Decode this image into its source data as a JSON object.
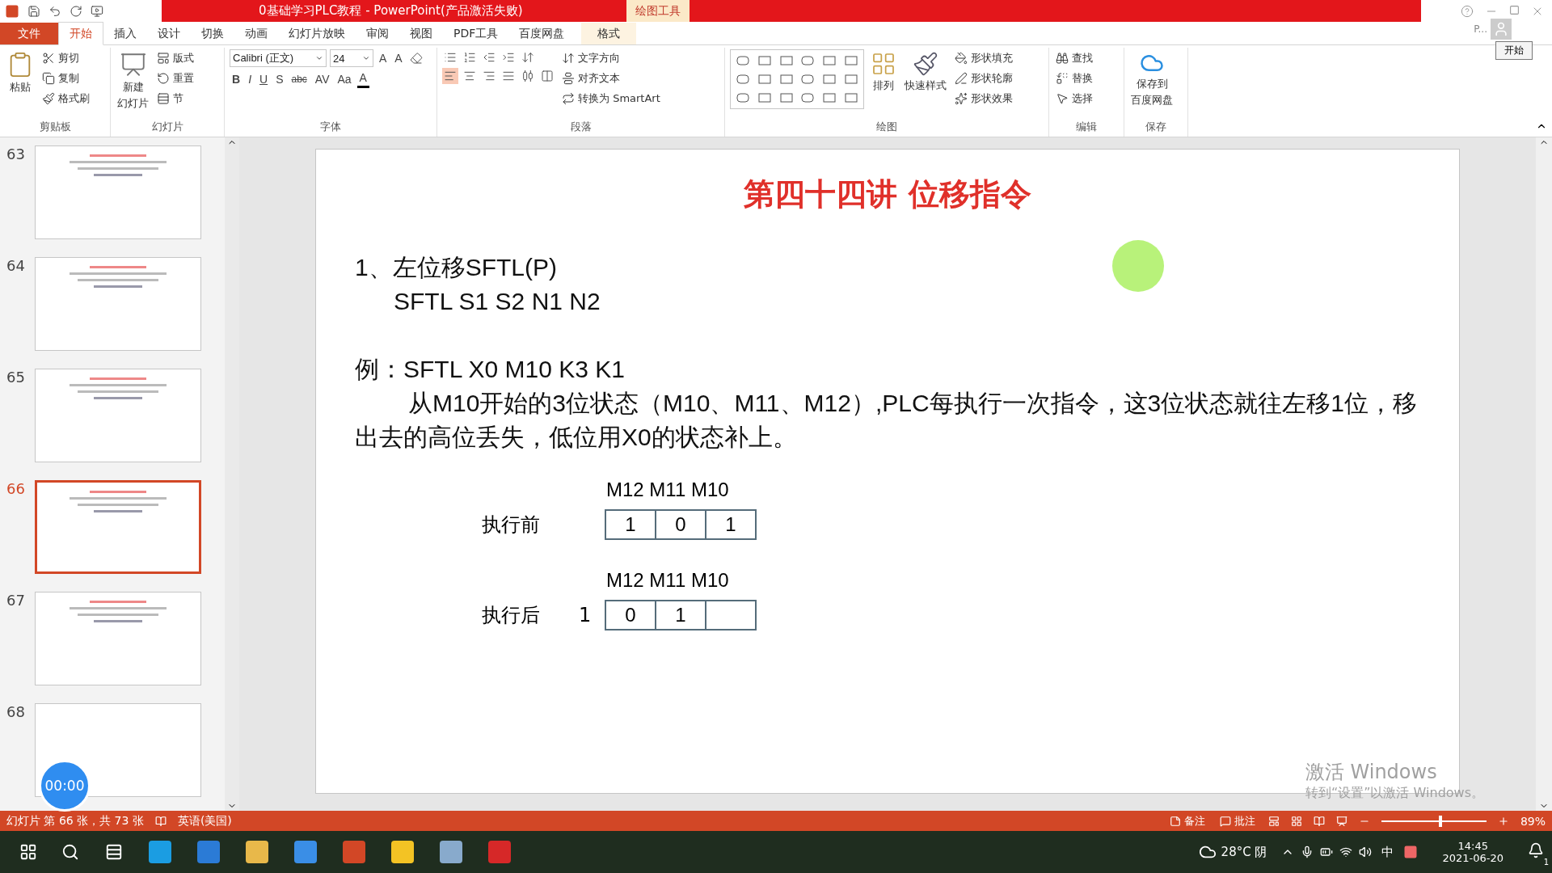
{
  "title_bar": {
    "title": "0基础学习PLC教程 -  PowerPoint(产品激活失败)",
    "context_tab": "绘图工具",
    "account": "P...",
    "tooltip": "开始"
  },
  "ribbon_tabs": [
    {
      "label": "文件",
      "kind": "file",
      "selected": false
    },
    {
      "label": "开始",
      "kind": "tab",
      "selected": true
    },
    {
      "label": "插入",
      "kind": "tab",
      "selected": false
    },
    {
      "label": "设计",
      "kind": "tab",
      "selected": false
    },
    {
      "label": "切换",
      "kind": "tab",
      "selected": false
    },
    {
      "label": "动画",
      "kind": "tab",
      "selected": false
    },
    {
      "label": "幻灯片放映",
      "kind": "tab",
      "selected": false
    },
    {
      "label": "审阅",
      "kind": "tab",
      "selected": false
    },
    {
      "label": "视图",
      "kind": "tab",
      "selected": false
    },
    {
      "label": "PDF工具",
      "kind": "tab",
      "selected": false
    },
    {
      "label": "百度网盘",
      "kind": "tab",
      "selected": false
    },
    {
      "label": "格式",
      "kind": "context",
      "selected": false
    }
  ],
  "ribbon_groups": [
    {
      "kind": "clipboard",
      "label": "剪贴板",
      "big": [
        [
          "粘贴"
        ]
      ],
      "small": [
        "剪切",
        "复制",
        "格式刷"
      ]
    },
    {
      "kind": "slides",
      "label": "幻灯片",
      "big": [
        [
          "新建",
          "幻灯片"
        ]
      ],
      "small": [
        "版式",
        "重置",
        "节"
      ]
    },
    {
      "kind": "font",
      "label": "字体",
      "font": "Calibri (正文)",
      "size": "24",
      "size_buttons": [
        "A",
        "A"
      ],
      "format_buttons": [
        "B",
        "I",
        "U",
        "S",
        "abc",
        "AV",
        "Aa",
        "A"
      ]
    },
    {
      "kind": "paragraph",
      "label": "段落",
      "small": [
        "文字方向",
        "对齐文本",
        "转换为 SmartArt"
      ],
      "align": [
        {
          "selected": true
        },
        {
          "selected": false
        },
        {
          "selected": false
        },
        {
          "selected": false
        },
        {
          "selected": false
        }
      ]
    },
    {
      "kind": "drawing",
      "label": "绘图",
      "big": [
        [
          "排列"
        ],
        [
          "快速样式"
        ]
      ],
      "small": [
        "形状填充",
        "形状轮廓",
        "形状效果"
      ]
    },
    {
      "kind": "editing",
      "label": "编辑",
      "small": [
        "查找",
        "替换",
        "选择"
      ]
    },
    {
      "kind": "save",
      "label": "保存",
      "big": [
        [
          "保存到",
          "百度网盘"
        ]
      ]
    }
  ],
  "thumbnails": [
    {
      "number": "63",
      "selected": false
    },
    {
      "number": "64",
      "selected": false
    },
    {
      "number": "65",
      "selected": false
    },
    {
      "number": "66",
      "selected": true
    },
    {
      "number": "67",
      "selected": false
    },
    {
      "number": "68",
      "selected": false
    }
  ],
  "slide": {
    "title": "第四十四讲  位移指令",
    "lines": [
      "1、左位移SFTL(P)",
      "SFTL  S1  S2  N1  N2"
    ],
    "example": "例：SFTL  X0  M10  K3  K1",
    "paragraph": "从M10开始的3位状态（M10、M11、M12）,PLC每执行一次指令，这3位状态就往左移1位，移出去的高位丢失，低位用X0的状态补上。",
    "rows": [
      {
        "header": "M12  M11 M10",
        "label": "执行前",
        "cells": [
          "1",
          "0",
          "1"
        ]
      },
      {
        "header": "M12  M11 M10",
        "label": "执行后",
        "outside": "1",
        "cells": [
          "0",
          "1"
        ]
      }
    ]
  },
  "timer": "00:00",
  "activation": {
    "title": "激活 Windows",
    "hint": "转到“设置”以激活 Windows。"
  },
  "status_bar": {
    "slide_info": "幻灯片 第 66 张，共 73 张",
    "language": "英语(美国)",
    "notes": "备注",
    "comments": "批注",
    "zoom": {
      "level": 0.55
    },
    "zoom_label": "89%"
  },
  "taskbar": {
    "weather": "28°C  阴",
    "ime": "中",
    "time": "14:45",
    "date": "2021-06-20",
    "notifications": "1"
  }
}
